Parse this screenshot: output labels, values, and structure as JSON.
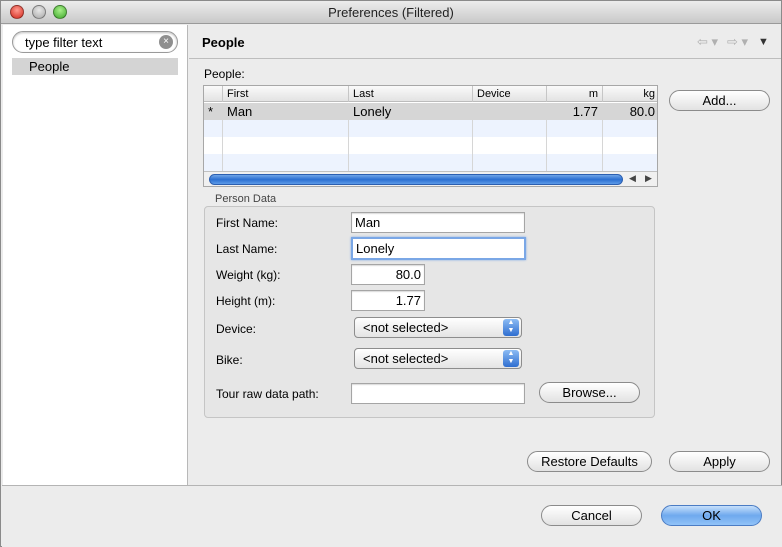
{
  "window": {
    "title": "Preferences (Filtered)"
  },
  "filter": {
    "value": "type filter text",
    "clear_icon": "×"
  },
  "tree": {
    "items": [
      {
        "label": "People"
      }
    ]
  },
  "page": {
    "title": "People",
    "nav": {
      "back_icon": "⇦ ▾",
      "forward_icon": "⇨ ▾",
      "menu_icon": "▼"
    }
  },
  "people": {
    "label": "People:",
    "add_button": "Add...",
    "columns": [
      "",
      "First",
      "Last",
      "Device",
      "m",
      "kg"
    ],
    "rows": [
      {
        "marker": "*",
        "first": "Man",
        "last": "Lonely",
        "device": "",
        "m": "1.77",
        "kg": "80.0"
      }
    ]
  },
  "person_data": {
    "group_title": "Person Data",
    "first_name_label": "First Name:",
    "first_name_value": "Man",
    "last_name_label": "Last Name:",
    "last_name_value": "Lonely",
    "weight_label": "Weight (kg):",
    "weight_value": "80.0",
    "height_label": "Height (m):",
    "height_value": "1.77",
    "device_label": "Device:",
    "device_value": "<not selected>",
    "bike_label": "Bike:",
    "bike_value": "<not selected>",
    "tour_path_label": "Tour raw data path:",
    "tour_path_value": "",
    "browse_button": "Browse..."
  },
  "page_buttons": {
    "restore_defaults": "Restore Defaults",
    "apply": "Apply"
  },
  "dialog_buttons": {
    "cancel": "Cancel",
    "ok": "OK"
  }
}
